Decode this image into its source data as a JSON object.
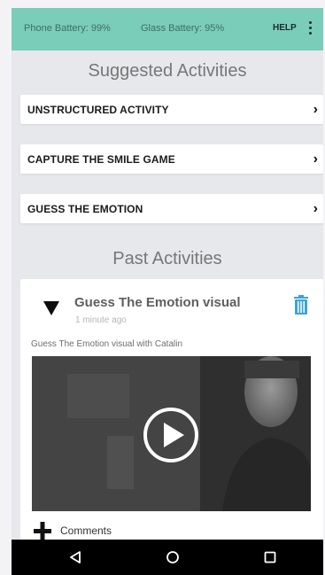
{
  "status": {
    "phone_battery": "Phone Battery: 99%",
    "glass_battery": "Glass Battery: 95%",
    "help_label": "HELP",
    "menu_icon": "more-vert-icon",
    "bar_color": "#79cdb9"
  },
  "suggested": {
    "heading": "Suggested Activities",
    "items": [
      {
        "label": "UNSTRUCTURED ACTIVITY",
        "icon": "chevron-right-icon"
      },
      {
        "label": "CAPTURE THE SMILE GAME",
        "icon": "chevron-right-icon"
      },
      {
        "label": "GUESS THE EMOTION",
        "icon": "chevron-right-icon"
      }
    ]
  },
  "past": {
    "heading": "Past Activities",
    "card": {
      "title": "Guess The Emotion visual",
      "time": "1 minute ago",
      "description": "Guess The Emotion visual with Catalin",
      "comments_label": "Comments",
      "delete_icon": "trash-icon",
      "collapse_icon": "triangle-down-icon",
      "video_icon": "play-circle-icon"
    }
  },
  "nav": {
    "back_icon": "back-triangle-icon",
    "home_icon": "home-circle-icon",
    "recents_icon": "recents-square-icon"
  }
}
